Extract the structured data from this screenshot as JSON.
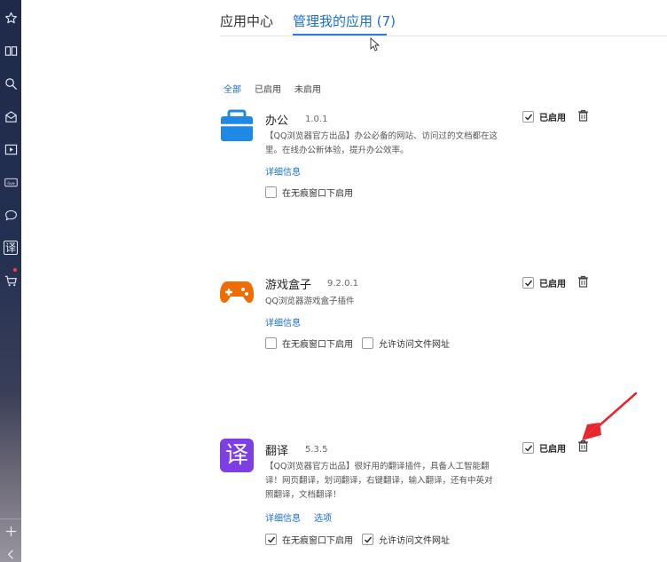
{
  "tabs": {
    "app_center": "应用中心",
    "manage_apps": "管理我的应用 (7)"
  },
  "filters": {
    "all": "全部",
    "enabled": "已启用",
    "disabled": "未启用"
  },
  "sidebar": {
    "items": [
      "star-icon",
      "book-icon",
      "search-icon",
      "mailbox-icon",
      "video-icon",
      "live-icon",
      "chat-icon",
      "translate-icon",
      "cart-icon",
      "plus-icon",
      "back-icon"
    ],
    "live_label": "live",
    "translate_label": "译"
  },
  "apps": [
    {
      "name": "办公",
      "version": "1.0.1",
      "description": "【QQ浏览器官方出品】办公必备的网站、访问过的文档都在这里。在线办公新体验，提升办公效率。",
      "details_link": "详细信息",
      "incognito_label": "在无痕窗口下启用",
      "incognito_checked": false,
      "enabled_label": "已启用",
      "enabled_checked": true,
      "icon": "briefcase-icon",
      "icon_color": "#1e88e5"
    },
    {
      "name": "游戏盒子",
      "version": "9.2.0.1",
      "description": "QQ浏览器游戏盒子插件",
      "details_link": "详细信息",
      "incognito_label": "在无痕窗口下启用",
      "incognito_checked": false,
      "file_access_label": "允许访问文件网址",
      "file_access_checked": false,
      "enabled_label": "已启用",
      "enabled_checked": true,
      "icon": "gamepad-icon",
      "icon_color": "#ef6c00"
    },
    {
      "name": "翻译",
      "version": "5.3.5",
      "description": "【QQ浏览器官方出品】很好用的翻译插件，具备人工智能翻译！网页翻译，划词翻译，右键翻译，输入翻译，还有中英对照翻译，文档翻译！",
      "details_link": "详细信息",
      "options_link": "选项",
      "incognito_label": "在无痕窗口下启用",
      "incognito_checked": true,
      "file_access_label": "允许访问文件网址",
      "file_access_checked": true,
      "enabled_label": "已启用",
      "enabled_checked": true,
      "icon": "translate-icon",
      "icon_glyph": "译",
      "icon_color": "#7b3fe4"
    }
  ],
  "colors": {
    "accent": "#1a6fd1",
    "annotation_arrow": "#e8262b"
  }
}
